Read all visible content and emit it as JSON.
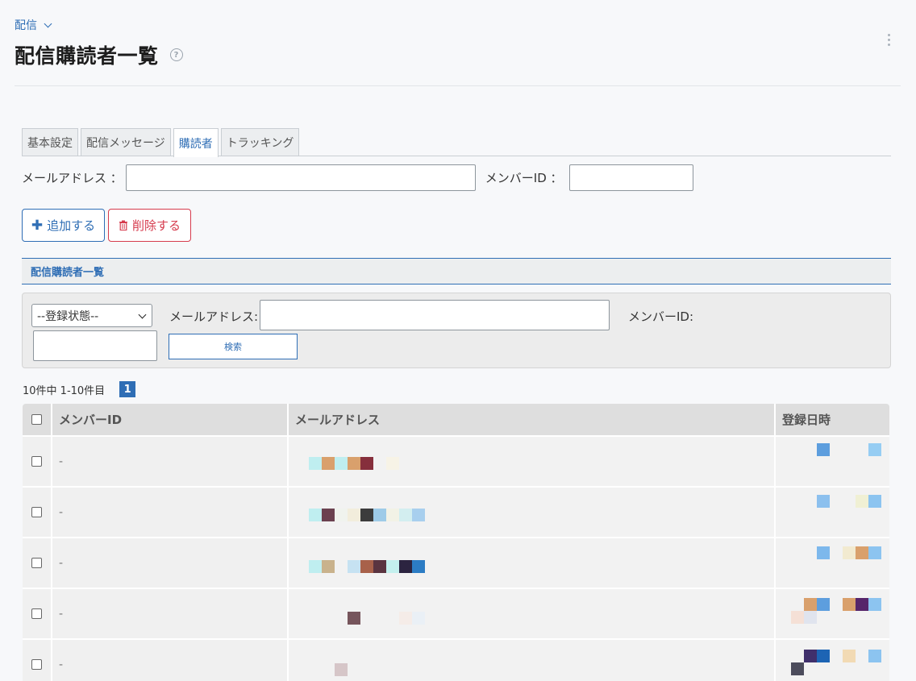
{
  "breadcrumb": {
    "label": "配信"
  },
  "page": {
    "title": "配信購読者一覧"
  },
  "tabs": [
    {
      "label": "基本設定",
      "active": false
    },
    {
      "label": "配信メッセージ",
      "active": false
    },
    {
      "label": "購読者",
      "active": true
    },
    {
      "label": "トラッキング",
      "active": false
    }
  ],
  "add_form": {
    "email_label": "メールアドレス ：",
    "email_value": "",
    "member_id_label": "メンバーID ：",
    "member_id_value": ""
  },
  "buttons": {
    "add": "追加する",
    "delete": "削除する"
  },
  "section": {
    "title": "配信購読者一覧"
  },
  "search": {
    "status_selected": "--登録状態--",
    "email_label": "メールアドレス:",
    "email_value": "",
    "member_id_label": "メンバーID:",
    "member_id_value": "",
    "button": "検索"
  },
  "pagination": {
    "summary": "10件中 1-10件目",
    "current_page": "1"
  },
  "table": {
    "columns": [
      "メンバーID",
      "メールアドレス",
      "登録日時"
    ],
    "rows": [
      {
        "member_id": "-"
      },
      {
        "member_id": "-"
      },
      {
        "member_id": "-"
      },
      {
        "member_id": "-"
      },
      {
        "member_id": "-"
      }
    ]
  },
  "colors": {
    "accent": "#2f6eb5",
    "danger": "#d63b4d"
  },
  "icons": {
    "help": "help-circle-icon",
    "add": "plus-icon",
    "delete": "trash-icon",
    "menu": "kebab-menu-icon"
  }
}
